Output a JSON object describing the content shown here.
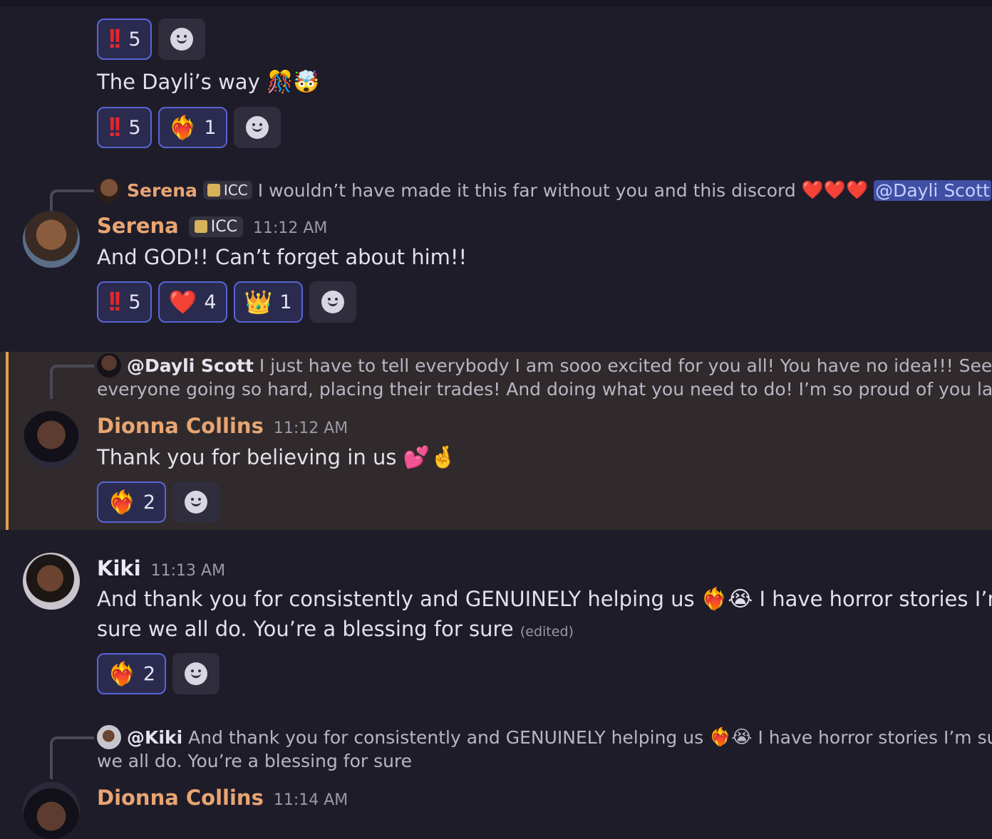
{
  "colors": {
    "background": "#1f1c2a",
    "reaction_border": "#5865d6",
    "reaction_bg": "#2a2b4f",
    "highlight_bg": "#302a2c",
    "highlight_bar": "#e2a04a",
    "username_orange": "#e8a572"
  },
  "block1": {
    "reactions": [
      {
        "emoji": "!!",
        "count": "5"
      }
    ]
  },
  "block2": {
    "text": "The Dayli’s way",
    "emojis": "🎊🤯",
    "reactions": [
      {
        "emoji": "!!",
        "count": "5"
      },
      {
        "emoji": "❤️‍🔥",
        "count": "1"
      }
    ]
  },
  "serena_msg": {
    "reply": {
      "author": "Serena",
      "tag": "ICC",
      "text": "I wouldn’t have made it this far without you and this discord",
      "emojis": "❤️❤️❤️",
      "mention": "@Dayli Scott"
    },
    "author": "Serena",
    "tag": "ICC",
    "time": "11:12 AM",
    "text": "And GOD!! Can’t forget about him!!",
    "reactions": [
      {
        "emoji": "!!",
        "count": "5"
      },
      {
        "emoji": "❤️",
        "count": "4"
      },
      {
        "emoji": "👑",
        "count": "1"
      }
    ]
  },
  "dionna_msg1": {
    "reply": {
      "mention": "@Dayli Scott",
      "line1": "I just have to tell everybody I am sooo excited for you all! You have no idea!!! Seeing",
      "line2": "everyone going so hard, placing their trades! And doing what you need to do! I’m so proud of you ladie..."
    },
    "author": "Dionna Collins",
    "time": "11:12 AM",
    "text": "Thank you for believing in us",
    "emojis": "💕🤞",
    "reactions": [
      {
        "emoji": "❤️‍🔥",
        "count": "2"
      }
    ]
  },
  "kiki_msg": {
    "author": "Kiki",
    "time": "11:13 AM",
    "line1": "And thank you for consistently and GENUINELY helping us",
    "emojis": "❤️‍🔥😭",
    "line1_end": "I have horror stories I’m",
    "line2": "sure we all do. You’re a blessing for sure",
    "edited": "(edited)",
    "reactions": [
      {
        "emoji": "❤️‍🔥",
        "count": "2"
      }
    ]
  },
  "dionna_msg2": {
    "reply": {
      "mention": "@Kiki",
      "line1": "And thank you for consistently and GENUINELY helping us",
      "emojis": "❤️‍🔥😭",
      "line1_end": "I have horror stories I’m sure",
      "line2": "we all do. You’re a blessing for sure"
    },
    "author": "Dionna Collins",
    "time": "11:14 AM"
  },
  "icons": {
    "add_reaction": "smiley-add-reaction-icon",
    "tag": "server-tag-icon"
  }
}
